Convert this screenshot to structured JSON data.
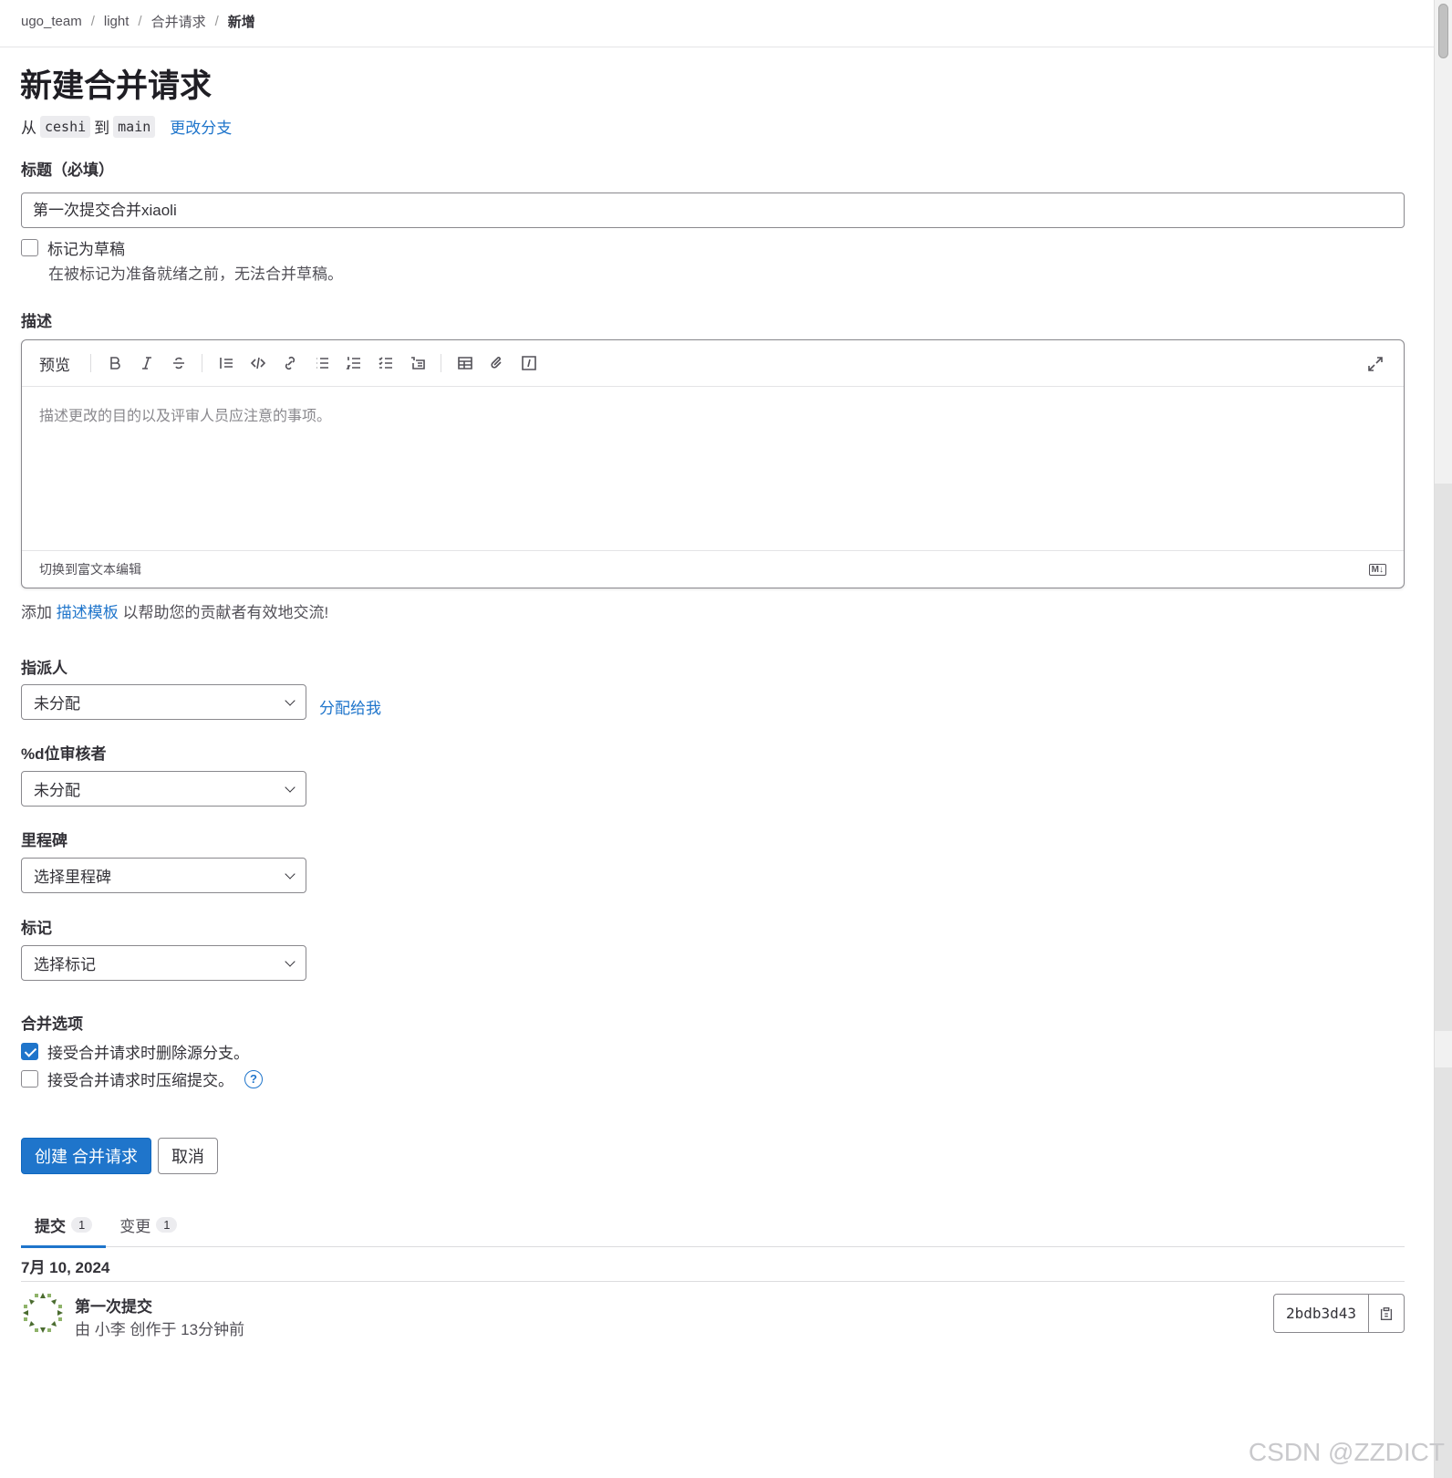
{
  "breadcrumb": {
    "items": [
      "ugo_team",
      "light",
      "合并请求"
    ],
    "current": "新增",
    "separator": "/"
  },
  "page_title": "新建合并请求",
  "branch": {
    "from_prefix": "从",
    "source": "ceshi",
    "to_prefix": "到",
    "target": "main",
    "change_link": "更改分支"
  },
  "title_field": {
    "label": "标题（必填）",
    "value": "第一次提交合并xiaoli"
  },
  "draft": {
    "label": "标记为草稿",
    "help": "在被标记为准备就绪之前，无法合并草稿。",
    "checked": false
  },
  "description": {
    "label": "描述",
    "preview_tab": "预览",
    "placeholder": "描述更改的目的以及评审人员应注意的事项。",
    "toolbar_icons": [
      "bold-icon",
      "italic-icon",
      "strikethrough-icon",
      "quote-icon",
      "code-icon",
      "link-icon",
      "bullet-list-icon",
      "numbered-list-icon",
      "task-list-icon",
      "collapsible-icon",
      "table-icon",
      "attach-icon",
      "slash-command-icon",
      "fullscreen-icon"
    ],
    "footer_switch": "切换到富文本编辑",
    "markdown_badge": "M↓"
  },
  "template_hint": {
    "prefix": "添加",
    "link": "描述模板",
    "suffix": "以帮助您的贡献者有效地交流!"
  },
  "assignee": {
    "label": "指派人",
    "value": "未分配",
    "assign_me": "分配给我"
  },
  "reviewers": {
    "label": "%d位审核者",
    "value": "未分配"
  },
  "milestone": {
    "label": "里程碑",
    "value": "选择里程碑"
  },
  "labels": {
    "label": "标记",
    "value": "选择标记"
  },
  "merge_options": {
    "label": "合并选项",
    "delete_source": {
      "label": "接受合并请求时删除源分支。",
      "checked": true
    },
    "squash": {
      "label": "接受合并请求时压缩提交。",
      "checked": false
    }
  },
  "actions": {
    "create": "创建 合并请求",
    "cancel": "取消"
  },
  "tabs": [
    {
      "label": "提交",
      "count": "1",
      "active": true
    },
    {
      "label": "变更",
      "count": "1",
      "active": false
    }
  ],
  "commits": {
    "date": "7月 10, 2024",
    "items": [
      {
        "title": "第一次提交",
        "meta": "由 小李 创作于 13分钟前",
        "sha": "2bdb3d43"
      }
    ]
  },
  "watermark": "CSDN @ZZDICT",
  "colors": {
    "accent": "#1f75cb",
    "text": "#333238",
    "border": "#89888d"
  }
}
